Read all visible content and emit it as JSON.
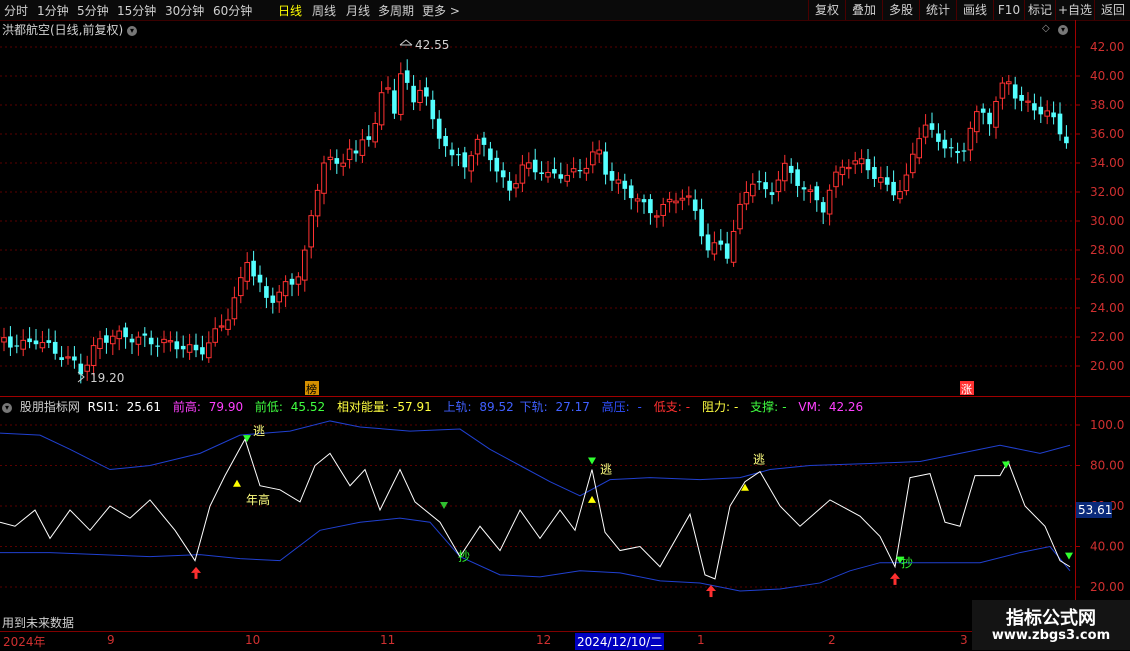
{
  "toolbar": {
    "periods": [
      "分时",
      "1分钟",
      "5分钟",
      "15分钟",
      "30分钟",
      "60分钟",
      "日线",
      "周线",
      "月线",
      "多周期",
      "更多 >"
    ],
    "active_period": "日线",
    "right_buttons": [
      "复权",
      "叠加",
      "多股",
      "统计",
      "画线",
      "F10",
      "标记",
      "+自选",
      "返回"
    ]
  },
  "main_chart": {
    "title": "洪都航空(日线,前复权)",
    "high_label": "42.55",
    "low_label": "19.20",
    "y_ticks": [
      "42.00",
      "40.00",
      "38.00",
      "36.00",
      "34.00",
      "32.00",
      "30.00",
      "28.00",
      "26.00",
      "24.00",
      "22.00",
      "20.00"
    ],
    "markers": {
      "left": "榜",
      "right": "涨"
    },
    "colors": {
      "up": "#ff3232",
      "down": "#54ffff",
      "grid": "#5a0000"
    }
  },
  "indicator": {
    "name": "股朋指标网",
    "rsi1_label": "RSI1:",
    "rsi1_value": "25.61",
    "prev_high_label": "前高:",
    "prev_high_value": "79.90",
    "prev_low_label": "前低:",
    "prev_low_value": "45.52",
    "energy_label": "相对能量:",
    "energy_value": "-57.91",
    "upper_label": "上轨:",
    "upper_value": "89.52",
    "lower_label": "下轨:",
    "lower_value": "27.17",
    "pressure_label": "高压:",
    "pressure_value": "-",
    "low_support_label": "低支:",
    "low_support_value": "-",
    "resist_label": "阻力:",
    "resist_value": "-",
    "support_label": "支撑:",
    "support_value": "-",
    "vm_label": "VM:",
    "vm_value": "42.26",
    "y_ticks": [
      "100.0",
      "80.00",
      "60.00",
      "40.00",
      "20.00"
    ],
    "current_value": "53.61",
    "signals": {
      "escape": "逃",
      "buy": "抄",
      "year_high": "年高"
    },
    "footer_note": "用到未来数据"
  },
  "date_axis": {
    "labels": [
      "2024年",
      "9",
      "10",
      "11",
      "12",
      "2024/12/10/二",
      "1",
      "2",
      "3"
    ]
  },
  "watermark": {
    "title": "指标公式网",
    "url": "www.zbgs3.com"
  }
}
